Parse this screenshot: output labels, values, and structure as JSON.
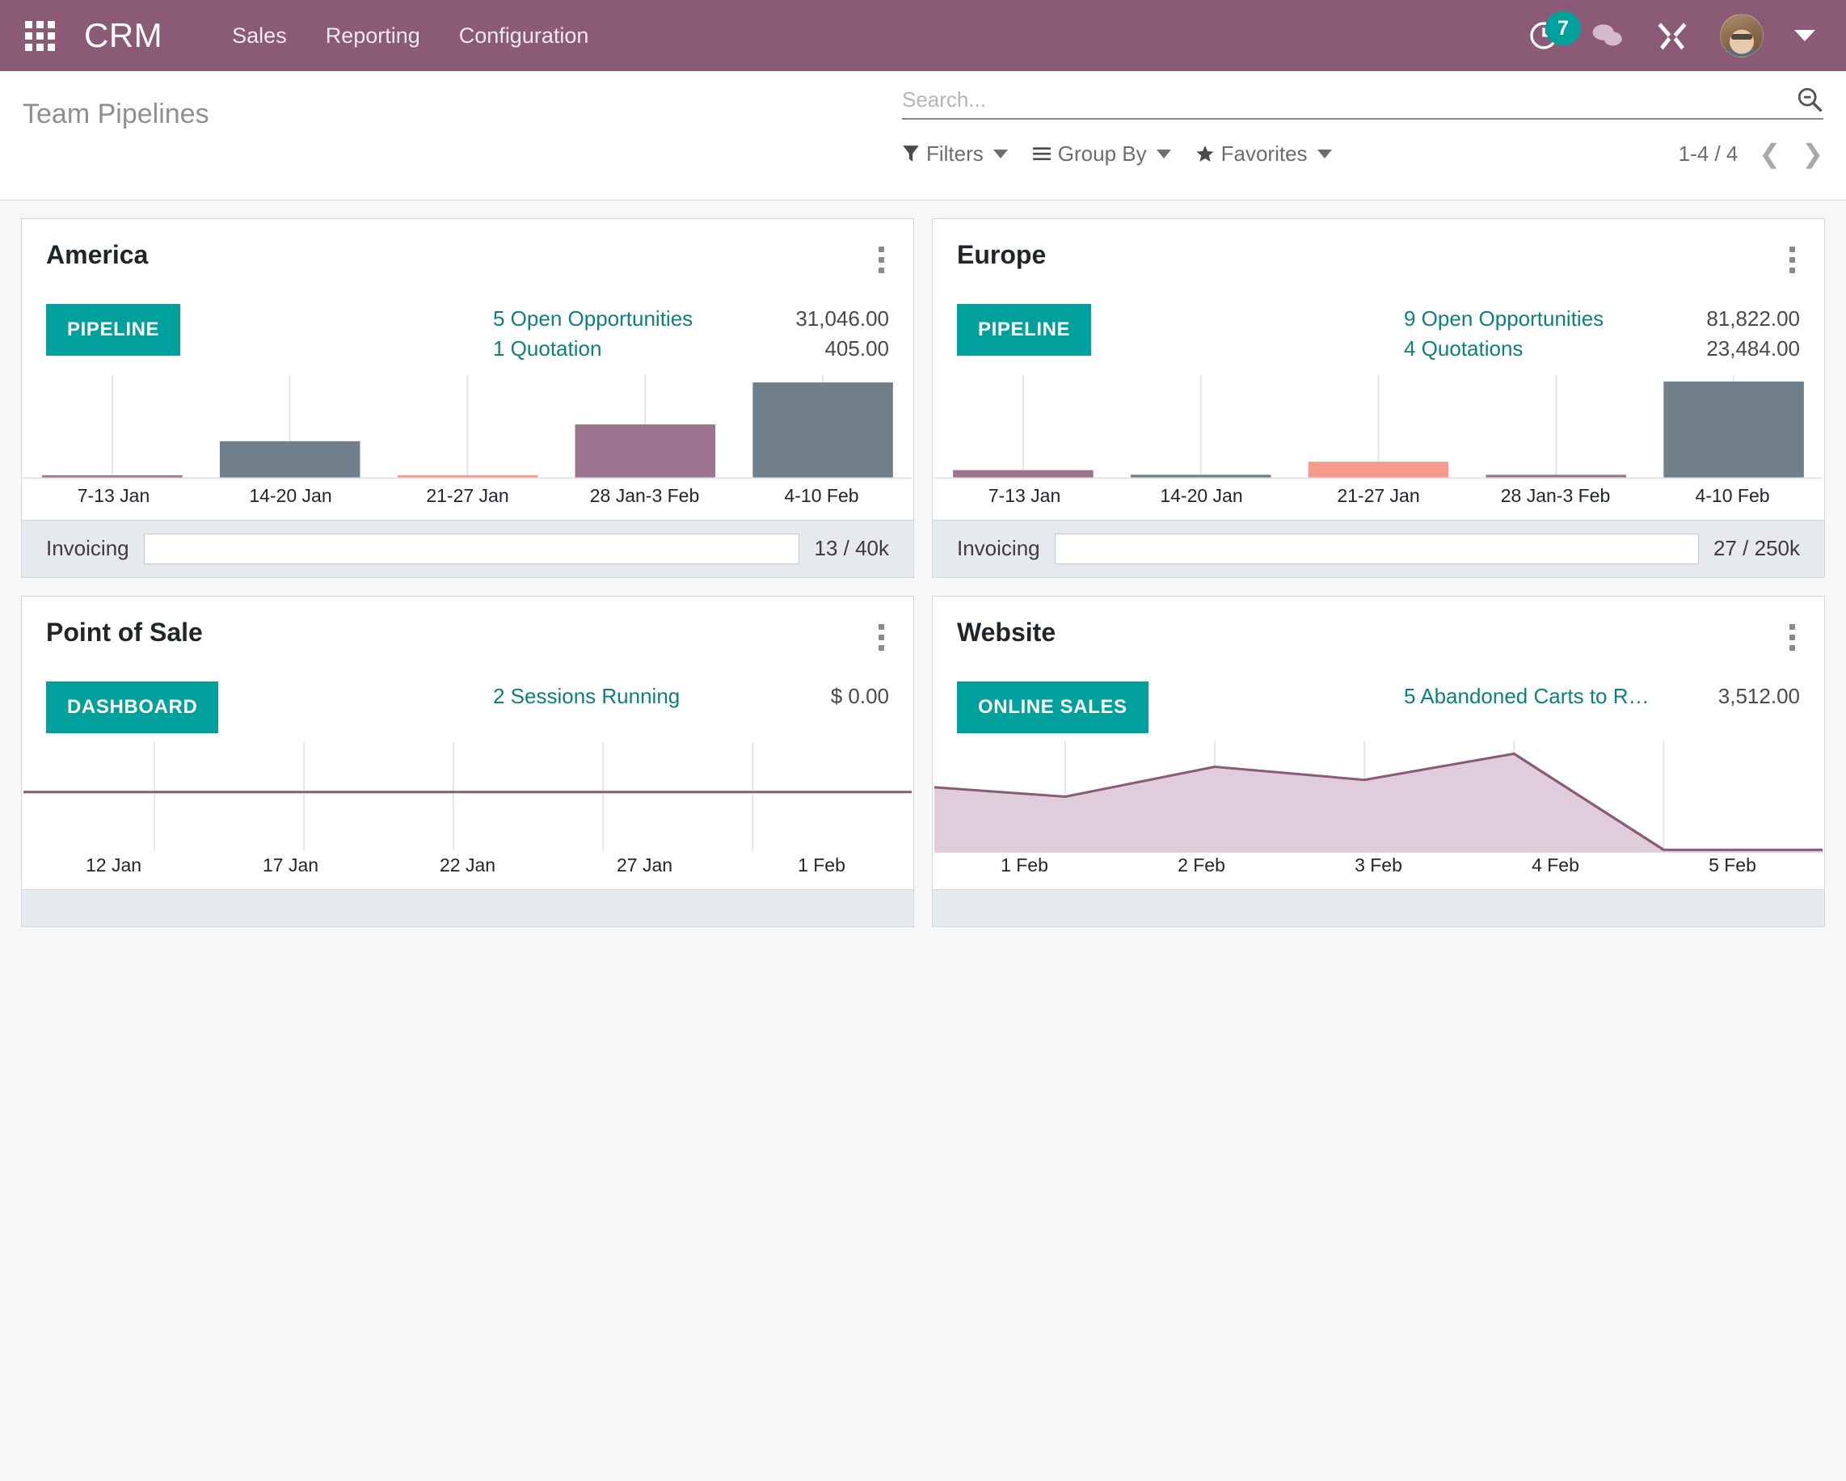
{
  "navbar": {
    "apps_icon": "apps-grid-icon",
    "brand": "CRM",
    "menu": [
      "Sales",
      "Reporting",
      "Configuration"
    ],
    "activity_icon": "clock-activity-icon",
    "activity_count": "7",
    "messages_icon": "chat-bubbles-icon",
    "tools_icon": "wrench-screwdriver-icon",
    "avatar_icon": "user-avatar",
    "caret_icon": "chevron-down-icon",
    "accent": "#8a5a76",
    "badge_color": "#00a09d"
  },
  "control_panel": {
    "title": "Team Pipelines",
    "search": {
      "value": "",
      "placeholder": "Search...",
      "icon": "search-icon"
    },
    "filters": [
      {
        "label": "Filters",
        "icon": "funnel-icon"
      },
      {
        "label": "Group By",
        "icon": "list-lines-icon"
      },
      {
        "label": "Favorites",
        "icon": "star-icon"
      }
    ],
    "pager": {
      "range": "1-4 / 4",
      "prev_icon": "chevron-left-icon",
      "next_icon": "chevron-right-icon"
    }
  },
  "cards": [
    {
      "title": "America",
      "kebab_icon": "kebab-menu-icon",
      "action": "PIPELINE",
      "stats": [
        {
          "label": "5 Open Opportunities",
          "value": "31,046.00"
        },
        {
          "label": "1 Quotation",
          "value": "405.00"
        }
      ],
      "footer": {
        "label": "Invoicing",
        "value": "13 / 40k",
        "progress_percent": 0
      }
    },
    {
      "title": "Europe",
      "kebab_icon": "kebab-menu-icon",
      "action": "PIPELINE",
      "stats": [
        {
          "label": "9 Open Opportunities",
          "value": "81,822.00"
        },
        {
          "label": "4 Quotations",
          "value": "23,484.00"
        }
      ],
      "footer": {
        "label": "Invoicing",
        "value": "27 / 250k",
        "progress_percent": 0
      }
    },
    {
      "title": "Point of Sale",
      "kebab_icon": "kebab-menu-icon",
      "action": "DASHBOARD",
      "stats": [
        {
          "label": "2 Sessions Running",
          "value": "$ 0.00"
        }
      ],
      "footer": null
    },
    {
      "title": "Website",
      "kebab_icon": "kebab-menu-icon",
      "action": "ONLINE SALES",
      "stats": [
        {
          "label": "5 Abandoned Carts to R…",
          "value": "3,512.00"
        }
      ],
      "footer": null
    }
  ],
  "chart_data": [
    {
      "type": "bar",
      "title": "America",
      "categories": [
        "7-13 Jan",
        "14-20 Jan",
        "21-27 Jan",
        "28 Jan-3 Feb",
        "4-10 Feb"
      ],
      "values": [
        2,
        36,
        2,
        52,
        80
      ],
      "colors": [
        "#9c7490",
        "#6f7f8c",
        "#f79a8c",
        "#9c7490",
        "#6f7f8c"
      ],
      "xlabel": "",
      "ylabel": "",
      "ylim": [
        0,
        100
      ],
      "grid": true,
      "legend": false
    },
    {
      "type": "bar",
      "title": "Europe",
      "categories": [
        "7-13 Jan",
        "14-20 Jan",
        "21-27 Jan",
        "28 Jan-3 Feb",
        "4-10 Feb"
      ],
      "values": [
        8,
        3,
        16,
        3,
        82
      ],
      "colors": [
        "#9c7490",
        "#6f7f8c",
        "#f79a8c",
        "#9c7490",
        "#6f7f8c"
      ],
      "xlabel": "",
      "ylabel": "",
      "ylim": [
        0,
        100
      ],
      "grid": true,
      "legend": false
    },
    {
      "type": "line",
      "title": "Point of Sale",
      "x": [
        "12 Jan",
        "17 Jan",
        "22 Jan",
        "27 Jan",
        "1 Feb"
      ],
      "values": [
        0,
        0,
        0,
        0,
        0
      ],
      "color": "#8a5a76",
      "xlabel": "",
      "ylabel": "",
      "ylim": [
        0,
        1
      ],
      "grid": true,
      "legend": false
    },
    {
      "type": "area",
      "title": "Website",
      "x": [
        "1 Feb",
        "2 Feb",
        "3 Feb",
        "4 Feb",
        "5 Feb"
      ],
      "values": [
        44,
        72,
        60,
        88,
        0
      ],
      "color": "#8a5a76",
      "fill": "#dfcddb",
      "xlabel": "",
      "ylabel": "",
      "ylim": [
        0,
        100
      ],
      "grid": true,
      "legend": false
    }
  ]
}
